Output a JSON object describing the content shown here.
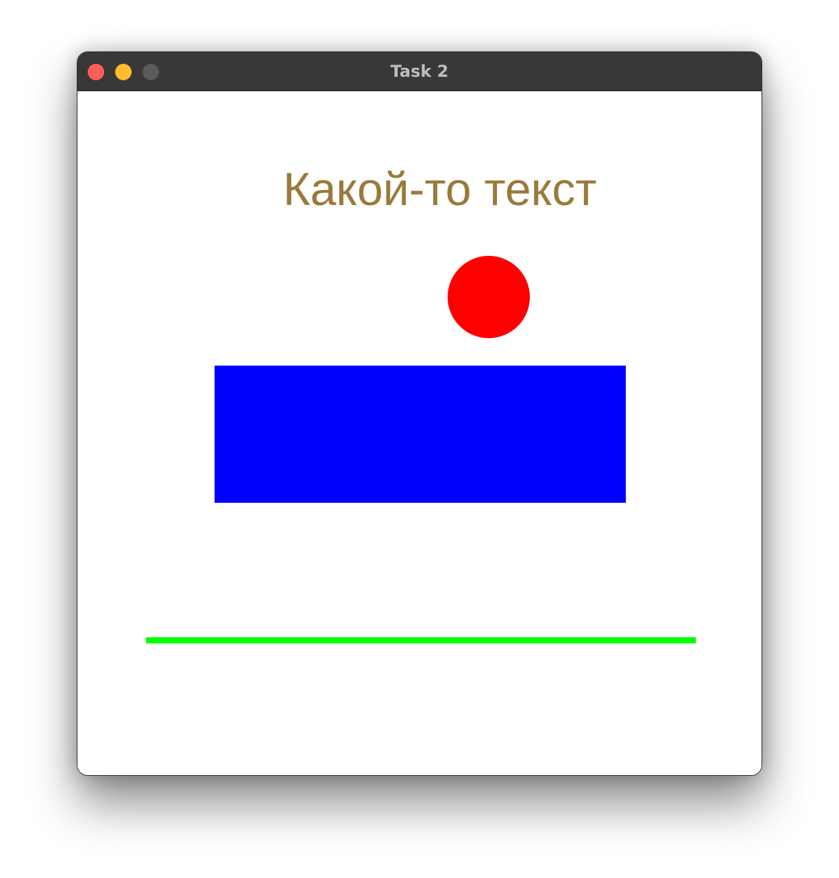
{
  "window": {
    "title": "Task 2",
    "controls": {
      "close_color": "#ff5f57",
      "minimize_color": "#febc2e",
      "zoom_color": "#5a5a5a"
    }
  },
  "canvas": {
    "text": "Какой-то текст",
    "text_color": "#9a7a3a",
    "circle_color": "#ff0000",
    "rectangle_color": "#0000ff",
    "line_color": "#00ff00"
  }
}
